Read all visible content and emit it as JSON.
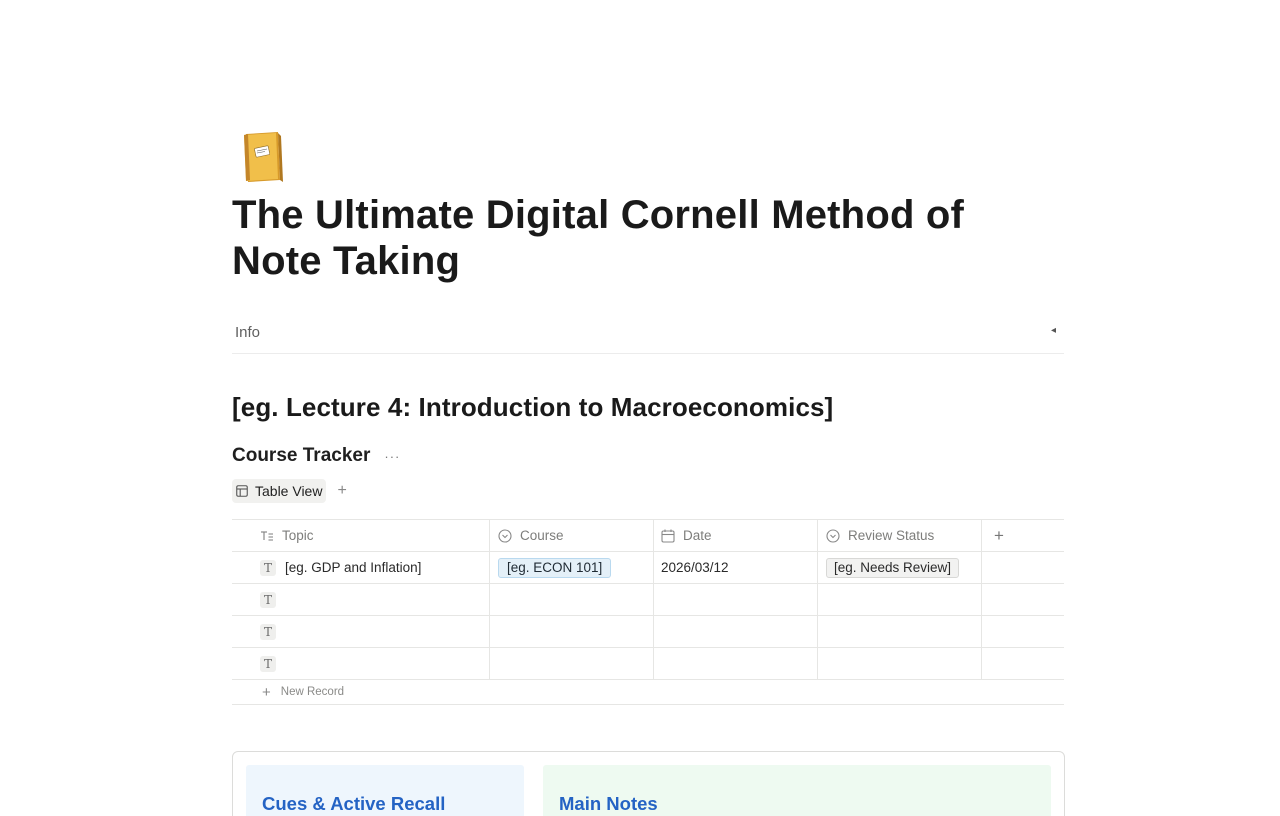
{
  "page": {
    "icon": "closed-book-emoji",
    "title": "The Ultimate Digital Cornell Method of Note Taking"
  },
  "info": {
    "label": "Info",
    "toggle": "◂"
  },
  "section_heading": "[eg. Lecture 4: Introduction to Macroeconomics]",
  "database": {
    "title": "Course Tracker",
    "more": "···",
    "view_tab": "Table View",
    "view_add": "+",
    "columns": [
      {
        "label": "Topic",
        "icon": "text-lines-icon"
      },
      {
        "label": "Course",
        "icon": "select-circle-icon"
      },
      {
        "label": "Date",
        "icon": "calendar-icon"
      },
      {
        "label": "Review Status",
        "icon": "select-circle-icon"
      }
    ],
    "add_column": "+",
    "rows": [
      {
        "topic": "[eg. GDP and Inflation]",
        "course": "[eg. ECON 101]",
        "date": "2026/03/12",
        "status": "[eg. Needs Review]"
      },
      {
        "topic": "",
        "course": "",
        "date": "",
        "status": ""
      },
      {
        "topic": "",
        "course": "",
        "date": "",
        "status": ""
      },
      {
        "topic": "",
        "course": "",
        "date": "",
        "status": ""
      }
    ],
    "row_icon": "T",
    "new_record_plus": "+",
    "new_record": "New Record"
  },
  "cornell": {
    "cues_title": "Cues & Active Recall",
    "notes_title": "Main Notes"
  },
  "colors": {
    "accent_blue": "#2463c4",
    "cues_bg": "#eef6fd",
    "notes_bg": "#eefaf1",
    "course_tag_bg": "#e4f0f8"
  }
}
